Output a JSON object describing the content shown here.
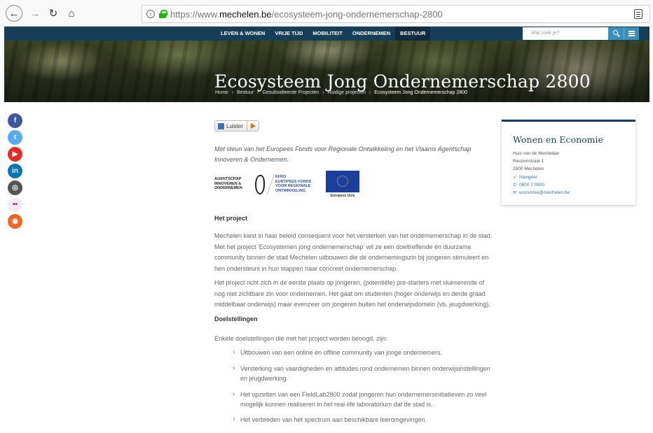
{
  "browser": {
    "url_scheme": "https://www.",
    "url_host": "mechelen.be",
    "url_path": "/ecosysteem-jong-ondernemerschap-2800"
  },
  "nav": {
    "items": [
      {
        "label": "LEVEN & WONEN",
        "active": false
      },
      {
        "label": "VRIJE TIJD",
        "active": false
      },
      {
        "label": "MOBILITEIT",
        "active": false
      },
      {
        "label": "ONDERNEMEN",
        "active": false
      },
      {
        "label": "BESTUUR",
        "active": true
      }
    ],
    "search_placeholder": "Wat zoek je?"
  },
  "hero": {
    "title": "Ecosysteem Jong Ondernemerschap 2800",
    "breadcrumb": [
      "Home",
      "Bestuur",
      "Gesubsidieerde Projecten",
      "Huidige projecten",
      "Ecosysteem Jong Ondernemerschap 2800"
    ]
  },
  "social": [
    {
      "icon": "facebook-icon",
      "glyph": "f",
      "color": "#3b5998"
    },
    {
      "icon": "twitter-icon",
      "glyph": "t",
      "color": "#55acee"
    },
    {
      "icon": "youtube-icon",
      "glyph": "▶",
      "color": "#e52d27"
    },
    {
      "icon": "linkedin-icon",
      "glyph": "in",
      "color": "#0077b5"
    },
    {
      "icon": "instagram-icon",
      "glyph": "◎",
      "color": "#555555"
    },
    {
      "icon": "flickr-icon",
      "glyph": "••",
      "color": "#eeeeee"
    },
    {
      "icon": "rss-icon",
      "glyph": "◉",
      "color": "#f26522"
    }
  ],
  "listen_label": "Luister",
  "intro": "Met steun van het Europees Fonds voor Regionale Ontwikkeling en het Vlaams Agentschap Innoveren & Ondernemen.",
  "logos": {
    "agentschap": [
      "AGENTSCHAP",
      "INNOVEREN &",
      "ONDERNEMEN"
    ],
    "efro": [
      "EFRO",
      "EUROPEES FONDS",
      "VOOR REGIONALE",
      "ONTWIKKELING"
    ],
    "eu_label": "Europese Unie"
  },
  "content": {
    "h_project": "Het project",
    "p1": "Mechelen kiest in haar beleid consequent voor het versterken van het ondernemerschap in de stad. Met het project 'Ecosystemen jong ondernemerschap' wil ze een doeltreffende én duurzame community binnen de stad Mechelen uitbouwen die de ondernemingszin bij jongeren stimuleert en hen ondersteunt in hun stappen naar concreet ondernemerschap.",
    "p2": "Het project richt zich in de eerste plaats op jongeren, (potentiële) pre-starters met sluimerende of nog niet zichtbare zin voor ondernemen. Het gaat om studenten (hoger onderwijs en derde graad middelbaar onderwijs) maar evenzeer om jongeren buiten het onderwijsdomein (vb. jeugdwerking).",
    "h_goals": "Doelstellingen",
    "p3": "Enkele doelstellingen die met het project worden beoogd, zijn:",
    "goals": [
      "Uitbouwen van een online en offline community van jonge ondernemers.",
      "Versterking van vaardigheden en attitudes rond ondernemen binnen onderwijsinstellingen en jeugdwerking.",
      "Het opzetten van een FieldLab2800 zodat jongeren hun ondernemersinitiatieven zo veel mogelijk kunnen realiseren in het real-life laboratorium dat de stad is.",
      "Het verbreden van het spectrum aan beschikbare leeromgevingen."
    ]
  },
  "card": {
    "title": "Wonen en Economie",
    "lines": [
      "Huis van de Mechelaar",
      "Reuzenstraat 1",
      "2800 Mechelen"
    ],
    "navigate": "Navigeer",
    "phone": "0800 2 0800",
    "email": "economie@mechelen.be"
  }
}
